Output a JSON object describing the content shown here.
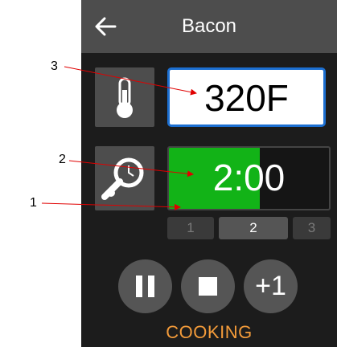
{
  "header": {
    "title": "Bacon",
    "back_icon": "arrow-left-icon"
  },
  "temperature": {
    "icon": "thermometer-icon",
    "value": "320F"
  },
  "timer": {
    "icon": "probe-timer-icon",
    "value": "2:00",
    "progress_fraction": 0.57,
    "progress_color": "#12b317"
  },
  "steps": [
    {
      "label": "1",
      "active": false
    },
    {
      "label": "2",
      "active": true
    },
    {
      "label": "3",
      "active": false
    }
  ],
  "controls": {
    "pause_icon": "pause-icon",
    "stop_icon": "stop-icon",
    "add_label": "+1"
  },
  "status": {
    "text": "COOKING",
    "color": "#f39b3a"
  },
  "callouts": [
    "1",
    "2",
    "3"
  ],
  "colors": {
    "accent_border": "#1c6fd1",
    "arrow": "#e00000"
  }
}
